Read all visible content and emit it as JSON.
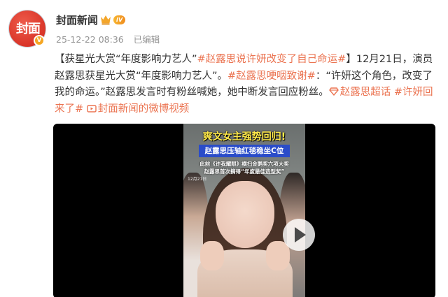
{
  "author": {
    "name": "封面新闻",
    "avatar_text": "封面",
    "avatar_badge": "V",
    "level_badge": "IV"
  },
  "post": {
    "timestamp": "25-12-22 08:36",
    "edited_label": "已编辑"
  },
  "content": {
    "t1": "【获星光大赏“年度影响力艺人”",
    "tag1": "#赵露思说许妍改变了自己命运#",
    "t2": "】12月21日，演员赵露思获星光大赏“年度影响力艺人”。",
    "tag2": "#赵露思哽咽致谢#",
    "t3": "：“许妍这个角色，改变了我的命运。”赵露思发言时有粉丝喊她，她中断发言回应粉丝。",
    "tag3": "赵露思超话",
    "tag4": "#许妍回来了#",
    "link": "封面新闻的微博视频"
  },
  "video": {
    "caption_title": "爽文女主强势回归!",
    "caption_box": "赵露思压轴红毯稳坐C位",
    "caption_line1": "此前《许我耀眼》横扫金鹅奖六项大奖",
    "caption_line2": "赵露思首次摘得“年度最佳造型奖”",
    "caption_date": "12月21日"
  },
  "icons": {
    "crown": "crown-icon",
    "super_topic": "diamond-icon",
    "video_link": "video-icon",
    "play": "play-icon"
  },
  "colors": {
    "tag": "#eb7350",
    "meta": "#939393",
    "avatar_red": "#d0251a",
    "caption_yellow": "#ffe94a",
    "caption_blue": "#2a4cc9"
  }
}
